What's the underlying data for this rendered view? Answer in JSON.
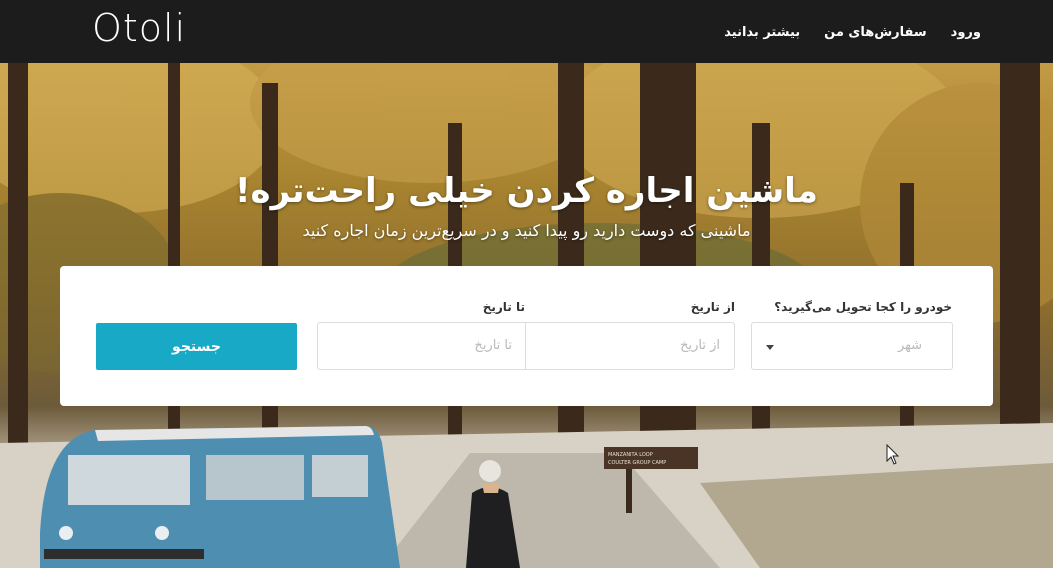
{
  "header": {
    "logo_text": "Otoli",
    "nav": {
      "login": "ورود",
      "my_orders": "سفارش‌های من",
      "learn_more": "بیشتر بدانید"
    }
  },
  "hero": {
    "title": "ماشین اجاره کردن خیلی راحت‌تره!",
    "subtitle": "ماشینی که دوست دارید رو پیدا کنید و در سریع‌ترین زمان اجاره کنید"
  },
  "search": {
    "location_label": "خودرو را کجا تحویل می‌گیرید؟",
    "location_placeholder": "شهر",
    "from_label": "از تاریخ",
    "from_placeholder": "از تاریخ",
    "to_label": "تا تاریخ",
    "to_placeholder": "تا تاریخ",
    "button_label": "جستجو"
  },
  "background_scene": {
    "sign_line1": "MANZANITA LOOP",
    "sign_line2": "COULTER GROUP CAMP"
  },
  "colors": {
    "header_bg": "#1c1c1c",
    "accent": "#17a9c6",
    "van_body": "#4d8eb1"
  }
}
